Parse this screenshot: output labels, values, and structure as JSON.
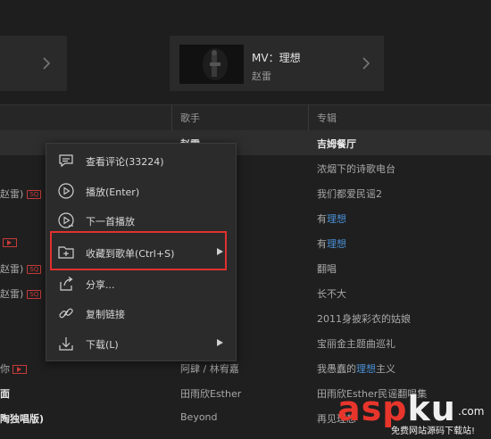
{
  "mv_card": {
    "label": "MV：理想",
    "artist": "赵雷"
  },
  "table_header": {
    "artist": "歌手",
    "album": "专辑"
  },
  "rows": [
    {
      "title": "",
      "artist": "赵雷",
      "album": "吉姆餐厅"
    },
    {
      "title": "",
      "artist": "",
      "album": "浓烟下的诗歌电台"
    },
    {
      "title": "赵雷)",
      "artist": "",
      "album": "我们都爱民谣2"
    },
    {
      "title": "",
      "artist": "",
      "album_prefix": "有",
      "album_hl": "理想"
    },
    {
      "title": "",
      "artist": "",
      "album_prefix": "有",
      "album_hl": "理想"
    },
    {
      "title": "赵雷)",
      "artist": "",
      "album": "翻唱"
    },
    {
      "title": "赵雷)",
      "artist": "",
      "album": "长不大"
    },
    {
      "title": "",
      "artist": "",
      "album": "2011身披彩衣的姑娘"
    },
    {
      "title": "",
      "artist": "",
      "album": "宝丽金主题曲巡礼"
    },
    {
      "title": "你",
      "artist": "阿肆 / 林宥嘉",
      "album_prefix": "我愚蠢的",
      "album_hl": "理想",
      "album_suffix": "主义"
    },
    {
      "title": "面",
      "artist": "田雨欣Esther",
      "album": "田雨欣Esther民谣翻唱集"
    },
    {
      "title": "陶独唱版)",
      "artist": "Beyond",
      "album": "再见理想"
    }
  ],
  "sq_tag": "SQ",
  "context_menu": {
    "items": [
      {
        "label": "查看评论(33224)",
        "icon": "comment-icon"
      },
      {
        "label": "播放(Enter)",
        "icon": "play-icon"
      },
      {
        "label": "下一首播放",
        "icon": "play-next-icon"
      },
      {
        "label": "收藏到歌单(Ctrl+S)",
        "icon": "folder-add-icon"
      },
      {
        "label": "分享...",
        "icon": "share-icon"
      },
      {
        "label": "复制链接",
        "icon": "link-icon"
      },
      {
        "label": "下载(L)",
        "icon": "download-icon"
      }
    ]
  },
  "watermark": {
    "a": "asp",
    "k": "ku",
    "com": ".com",
    "sub": "免费网站源码下载站!"
  },
  "colors": {
    "accent_red": "#e0302e",
    "highlight_blue": "#4a90d6",
    "menu_bg": "#2b2b2b"
  }
}
